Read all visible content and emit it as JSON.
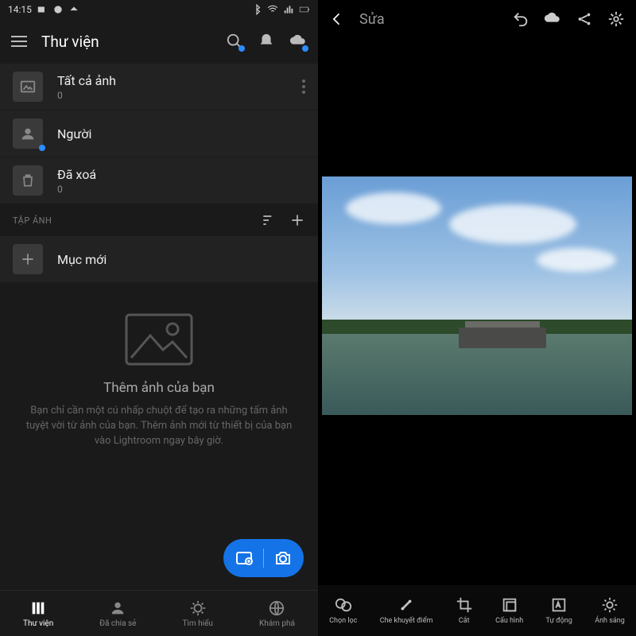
{
  "status": {
    "time": "14:15"
  },
  "header": {
    "title": "Thư viện"
  },
  "library": {
    "rows": [
      {
        "title": "Tất cả ảnh",
        "count": "0"
      },
      {
        "title": "Người"
      },
      {
        "title": "Đã xoá",
        "count": "0"
      }
    ],
    "section_label": "TẬP ẢNH",
    "new_item": "Mục mới"
  },
  "empty_state": {
    "title": "Thêm ảnh của bạn",
    "body": "Bạn chỉ cần một cú nhấp chuột để tạo ra những tấm ảnh tuyệt vời từ ảnh của bạn. Thêm ảnh mới từ thiết bị của bạn vào Lightroom ngay bây giờ."
  },
  "bottom_nav": [
    {
      "label": "Thư viện"
    },
    {
      "label": "Đã chia sẻ"
    },
    {
      "label": "Tìm hiểu"
    },
    {
      "label": "Khám phá"
    }
  ],
  "editor": {
    "top_title": "Sửa",
    "tools": [
      {
        "label": "Chọn lọc"
      },
      {
        "label": "Che khuyết điểm"
      },
      {
        "label": "Cắt"
      },
      {
        "label": "Cấu hình"
      },
      {
        "label": "Tự động"
      },
      {
        "label": "Ánh sáng"
      }
    ]
  }
}
